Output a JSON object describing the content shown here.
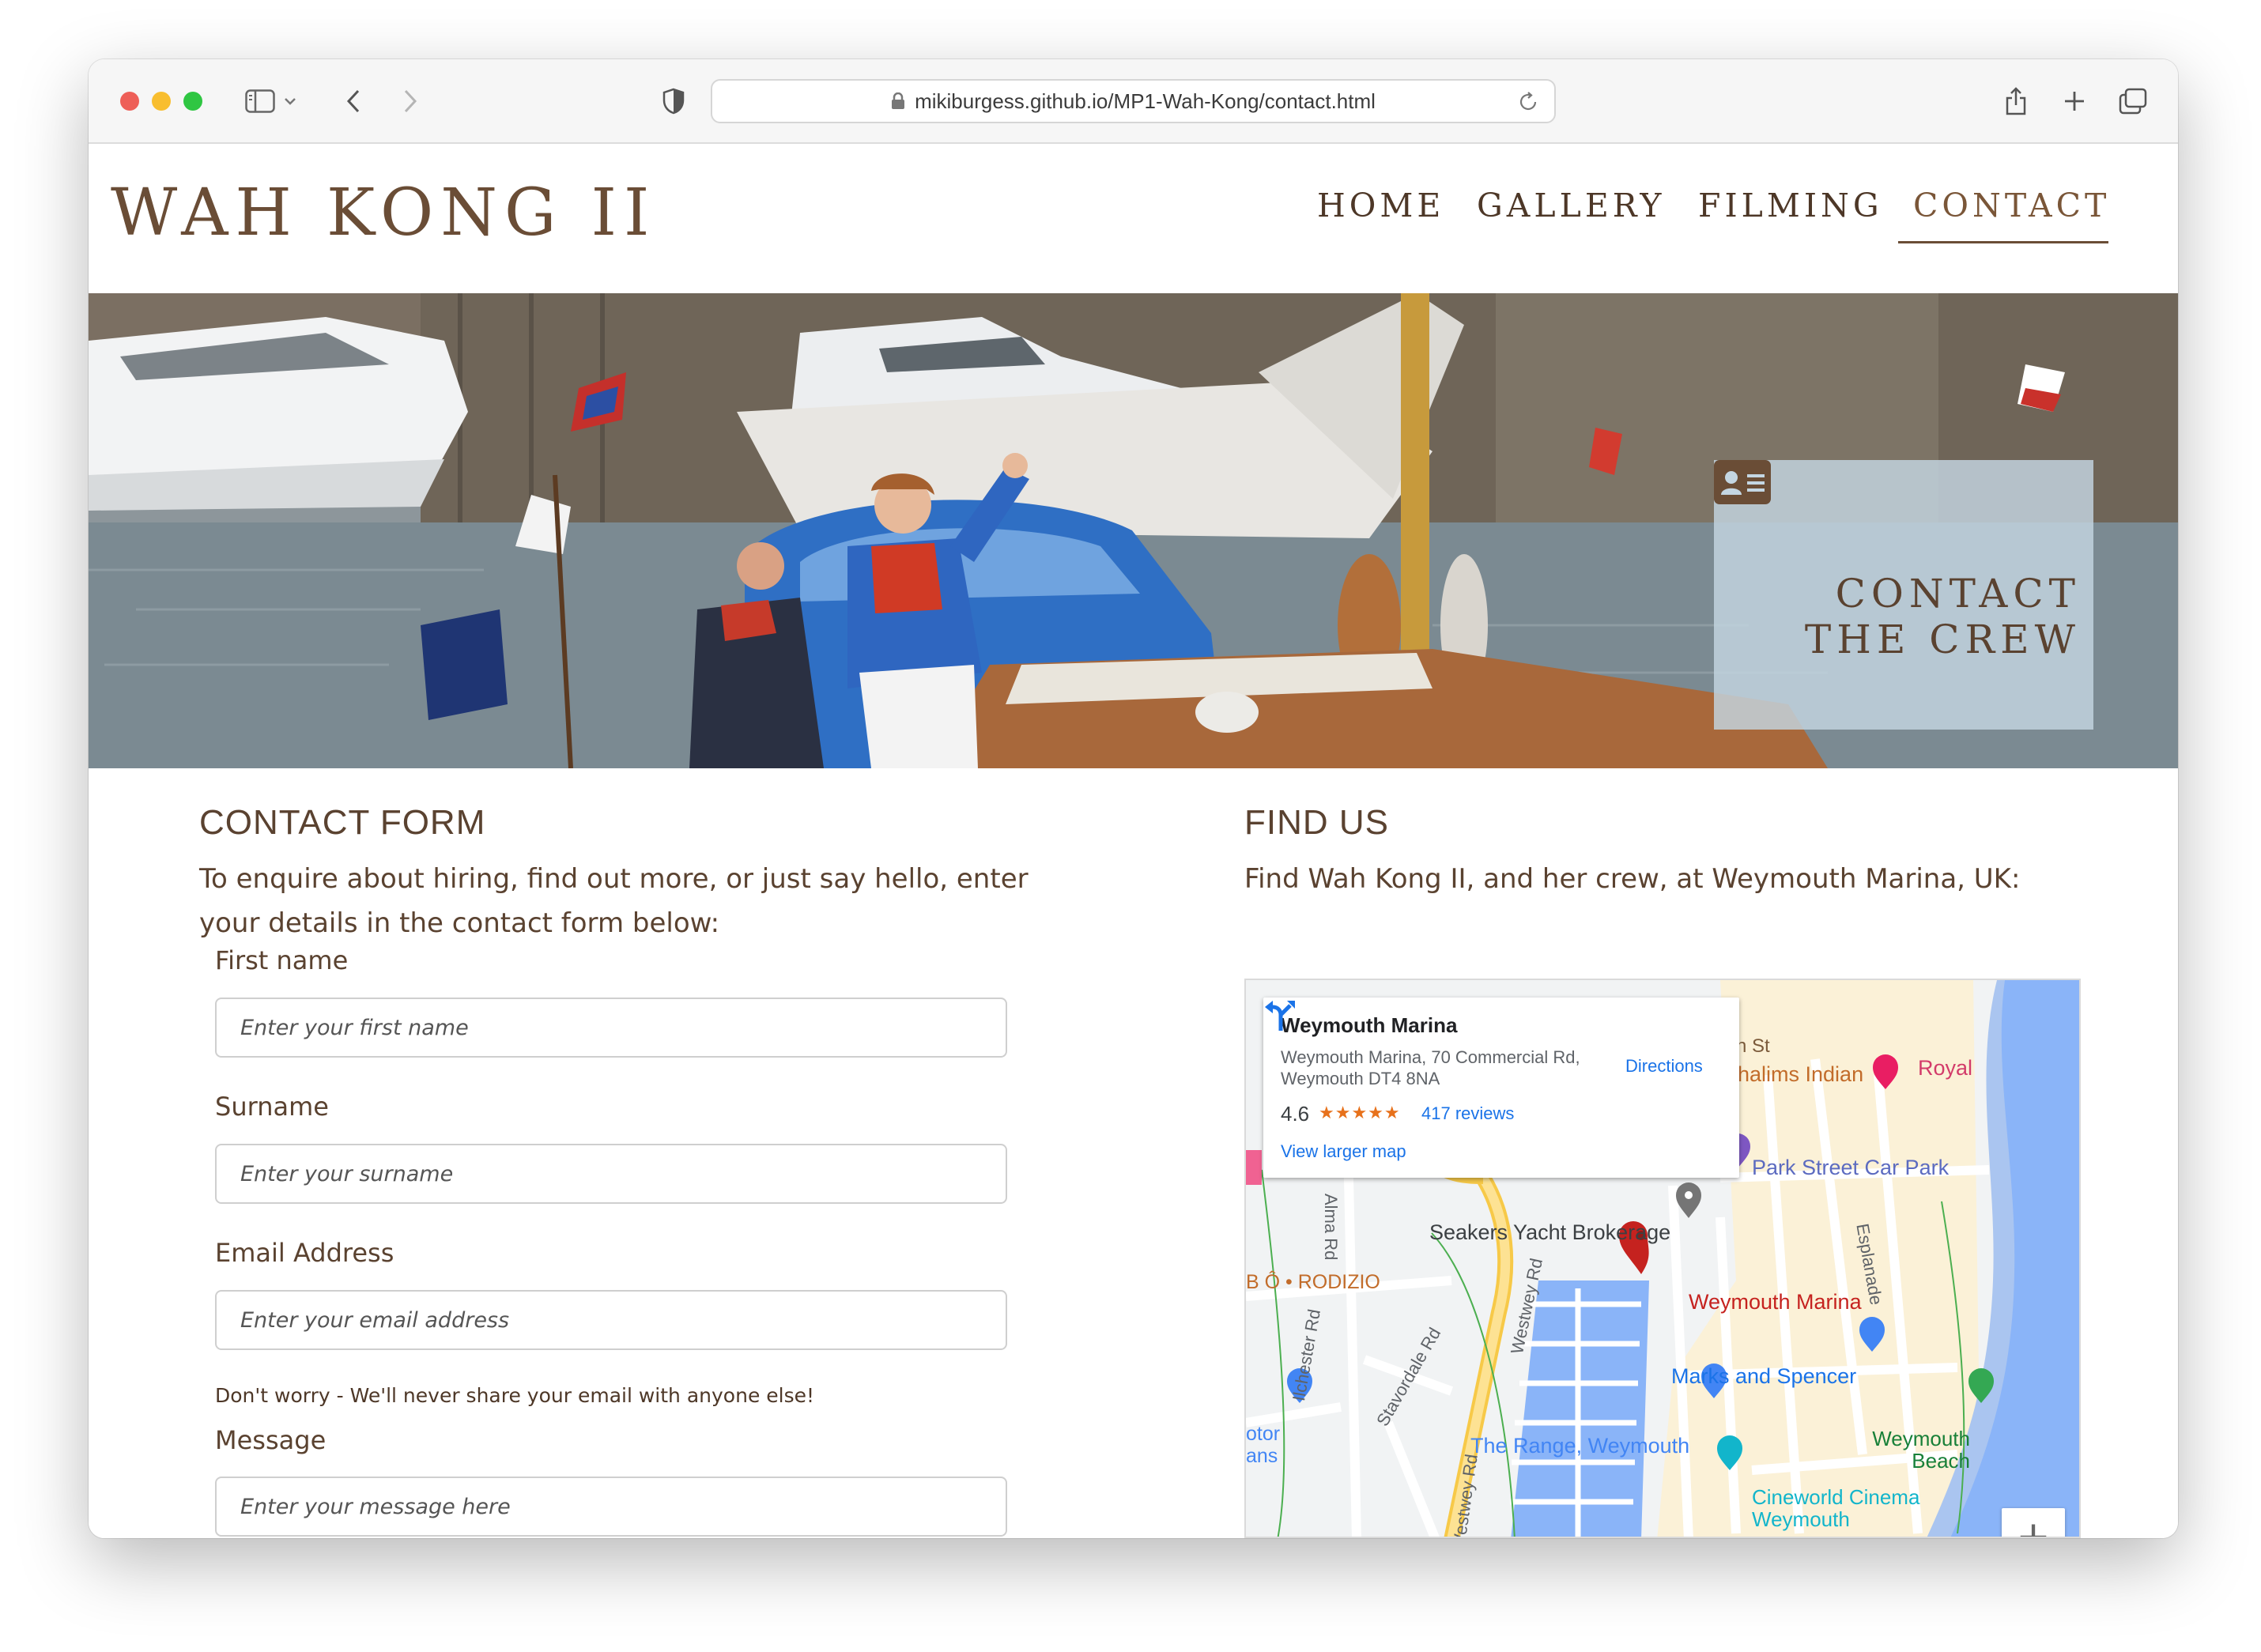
{
  "browser": {
    "url": "mikiburgess.github.io/MP1-Wah-Kong/contact.html"
  },
  "site": {
    "brand": "WAH KONG II",
    "nav": {
      "home": "HOME",
      "gallery": "GALLERY",
      "filming": "FILMING",
      "contact": "CONTACT",
      "active": "contact"
    },
    "colors": {
      "brand_brown": "#6a4d36",
      "text_brown": "#5a4230",
      "hero_box": "#c4d6e2"
    }
  },
  "hero": {
    "title": "CONTACT THE CREW",
    "icon": "id-card-icon"
  },
  "contact_form": {
    "heading": "CONTACT FORM",
    "intro": "To enquire about hiring, find out more, or just say hello, enter your details in the contact form below:",
    "fields": {
      "first_name": {
        "label": "First name",
        "placeholder": "Enter your first name",
        "value": ""
      },
      "surname": {
        "label": "Surname",
        "placeholder": "Enter your surname",
        "value": ""
      },
      "email": {
        "label": "Email Address",
        "placeholder": "Enter your email address",
        "value": "",
        "help": "Don't worry - We'll never share your email with anyone else!"
      },
      "message": {
        "label": "Message",
        "placeholder": "Enter your message here",
        "value": ""
      }
    }
  },
  "find_us": {
    "heading": "FIND US",
    "intro": "Find Wah Kong II, and her crew, at Weymouth Marina, UK:",
    "map": {
      "place_card": {
        "title": "Weymouth Marina",
        "address": "Weymouth Marina, 70 Commercial Rd, Weymouth DT4 8NA",
        "rating": "4.6",
        "stars": "★★★★★",
        "reviews": "417 reviews",
        "larger_map": "View larger map",
        "directions": "Directions"
      },
      "labels": {
        "st": "h St",
        "indian": "halims Indian",
        "royal": "Royal",
        "park_street": "Park Street Car Park",
        "alma_rd": "Alma Rd",
        "seakers": "Seakers Yacht Brokerage",
        "esplanade": "Esplanade",
        "rodizio": "B Ô • RODIZIO",
        "westwey_rd": "Westwey Rd",
        "marina": "Weymouth Marina",
        "ilchester": "Ilchester Rd",
        "stavordale": "Stavordale Rd",
        "marks": "Marks and Spencer",
        "otor": "otor",
        "ans": "ans",
        "the_range": "The Range, Weymouth",
        "beach": "Weymouth Beach",
        "westwey_rd_2": "Westwey Rd",
        "cineworld": "Cineworld Cinema Weymouth"
      },
      "zoom_in": "+"
    }
  }
}
